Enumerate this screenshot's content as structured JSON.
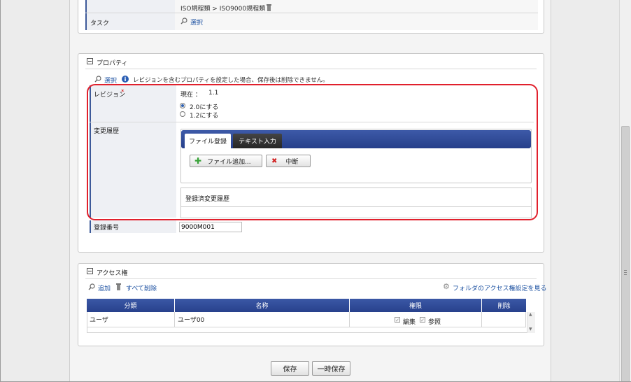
{
  "top_section": {
    "breadcrumb_path": "ISO規程類 > ISO9000規程類",
    "task_label": "タスク",
    "task_select": "選択"
  },
  "property_section": {
    "title": "プロパティ",
    "select_link": "選択",
    "info_text": "レビジョンを含むプロパティを設定した場合、保存後は削除できません。",
    "revision_label": "レビジョン",
    "required_mark": "*",
    "current_label": "現在 ：",
    "current_value": "1.1",
    "radio_options": [
      {
        "label": "2.0にする",
        "selected": true
      },
      {
        "label": "1.2にする",
        "selected": false
      }
    ],
    "history_label": "変更履歴",
    "tabs": [
      {
        "label": "ファイル登録",
        "active": true
      },
      {
        "label": "テキスト入力",
        "active": false
      }
    ],
    "add_file_button": "ファイル追加...",
    "abort_button": "中断",
    "registered_history_title": "登録済変更履歴",
    "registration_number_label": "登録番号",
    "registration_number_value": "9000M001"
  },
  "access_section": {
    "title": "アクセス権",
    "add_link": "追加",
    "delete_all_link": "すべて削除",
    "folder_settings_link": "フォルダのアクセス権設定を見る",
    "columns": [
      "分類",
      "名称",
      "権限",
      "削除"
    ],
    "rows": [
      {
        "category": "ユーザ",
        "name": "ユーザ00",
        "perm_edit": "編集",
        "perm_view": "参照"
      }
    ]
  },
  "footer": {
    "save_button": "保存",
    "temp_save_button": "一時保存"
  },
  "colors": {
    "accent_blue": "#2d4a9a",
    "highlight_red": "#e1202c",
    "link_blue": "#1a4fa0"
  }
}
